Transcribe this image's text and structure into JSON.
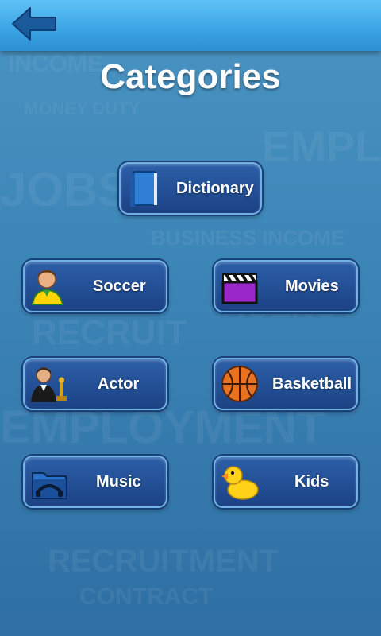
{
  "screen": {
    "title": "Categories"
  },
  "header": {
    "back_icon": "left-arrow-icon",
    "accent_color": "#3aa3e3"
  },
  "categories": [
    {
      "label": "Dictionary",
      "icon": "book-icon"
    },
    {
      "label": "Soccer",
      "icon": "soccer-player-icon"
    },
    {
      "label": "Movies",
      "icon": "clapperboard-icon"
    },
    {
      "label": "Actor",
      "icon": "actor-oscar-icon"
    },
    {
      "label": "Basketball",
      "icon": "basketball-icon"
    },
    {
      "label": "Music",
      "icon": "music-folder-icon"
    },
    {
      "label": "Kids",
      "icon": "rubber-duck-icon"
    }
  ]
}
